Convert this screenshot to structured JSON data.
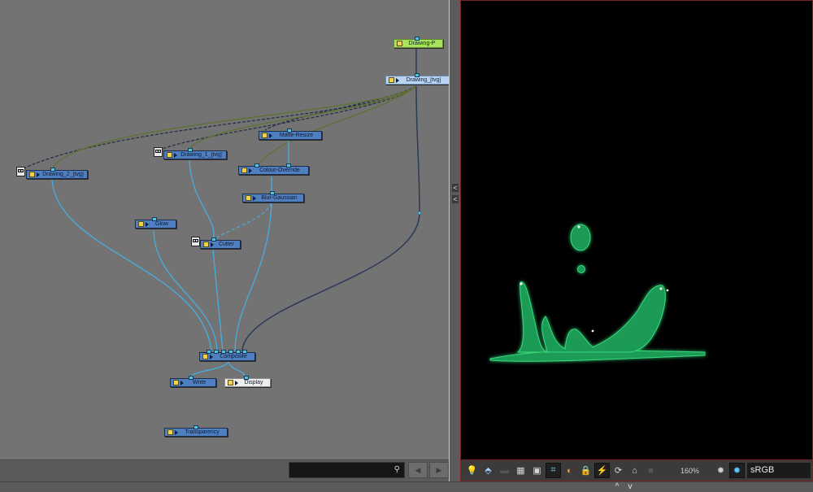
{
  "node_view": {
    "nodes": {
      "drawing_p": "Drawing-P",
      "drawing": "Drawing_[tvg]",
      "matte_resize": "Matte-Resize",
      "drawing_1": "Drawing_1_[tvg]",
      "drawing_2": "Drawing_2_[tvg]",
      "colour_override": "Colour-Override",
      "blur_gaussian": "Blur-Gaussian",
      "glow": "Glow",
      "cutter": "Cutter",
      "composite": "Composite",
      "write": "Write",
      "display": "Display",
      "transparency": "Transparency"
    },
    "search": {
      "placeholder": "",
      "icon": "search-icon"
    },
    "nav": {
      "prev": "◀",
      "next": "▶"
    }
  },
  "splitter": {
    "collapse_left": "<",
    "collapse_right": "<"
  },
  "viewer": {
    "zoom_label": "160%",
    "color_space": "sRGB",
    "toolbar_icons": [
      "lightbulb-icon",
      "paint-bucket-icon",
      "mask-icon",
      "grid-icon",
      "safe-area-icon",
      "crop-icon",
      "onion-skin-icon",
      "lock-icon",
      "lightning-icon",
      "rotate-icon",
      "camera-rig-icon",
      "camera-icon",
      "gear-icon",
      "gear-active-icon"
    ],
    "splash_color": "#27b867"
  },
  "bottom_strip": {
    "up": "^",
    "down": "v"
  }
}
